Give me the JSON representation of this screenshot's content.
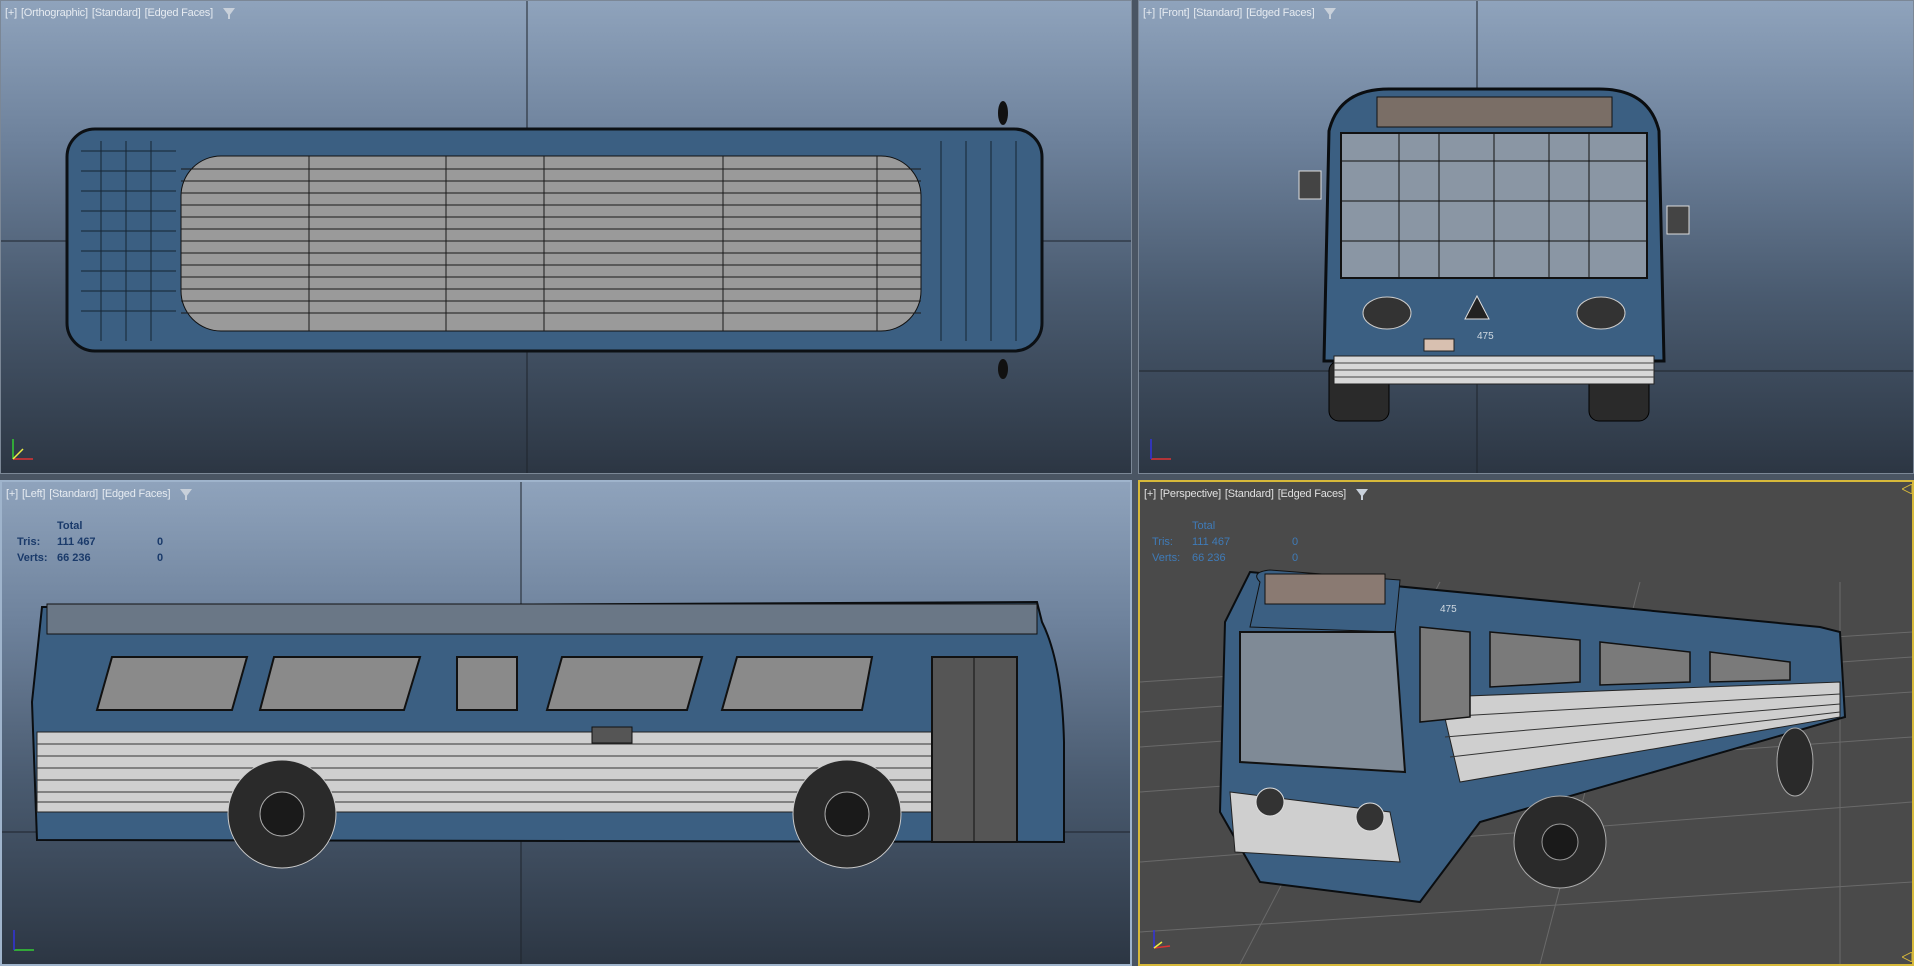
{
  "viewports": {
    "top": {
      "labels": [
        "[+]",
        "[Orthographic]",
        "[Standard]",
        "[Edged Faces]"
      ]
    },
    "front": {
      "labels": [
        "[+]",
        "[Front]",
        "[Standard]",
        "[Edged Faces]"
      ]
    },
    "left": {
      "labels": [
        "[+]",
        "[Left]",
        "[Standard]",
        "[Edged Faces]"
      ],
      "stats": {
        "header": "Total",
        "tris_label": "Tris:",
        "tris_value": "111 467",
        "tris_sel": "0",
        "verts_label": "Verts:",
        "verts_value": "66 236",
        "verts_sel": "0"
      }
    },
    "persp": {
      "labels": [
        "[+]",
        "[Perspective]",
        "[Standard]",
        "[Edged Faces]"
      ],
      "stats": {
        "header": "Total",
        "tris_label": "Tris:",
        "tris_value": "111 467",
        "tris_sel": "0",
        "verts_label": "Verts:",
        "verts_value": "66 236",
        "verts_sel": "0"
      }
    }
  },
  "model": {
    "bus_number": "475"
  },
  "icons": {
    "filter": "filter-icon",
    "axis": "axis-gizmo-icon"
  },
  "colors": {
    "body_blue": "#3b5f82",
    "stripe_white": "#d8d8d8",
    "wire": "#101418",
    "persp_active": "#d7b93a"
  }
}
